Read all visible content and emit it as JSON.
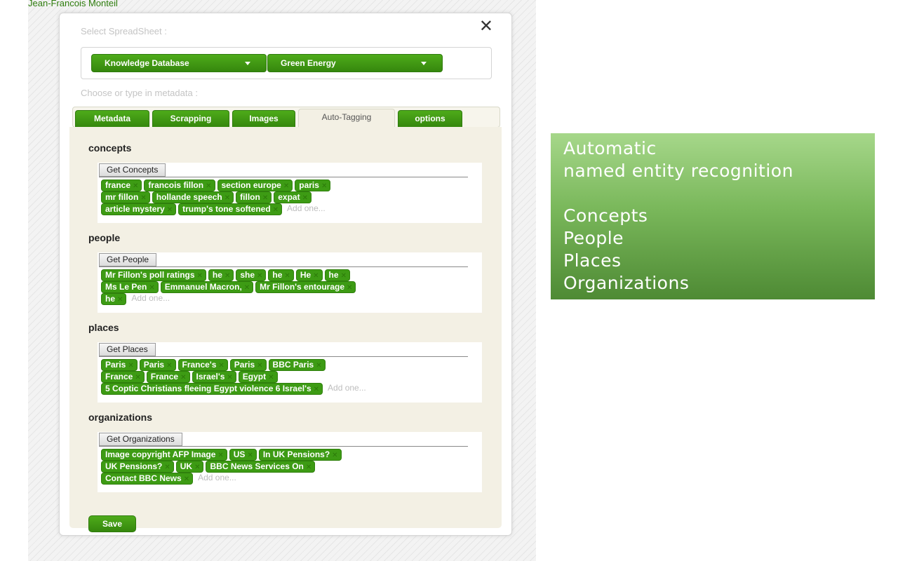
{
  "header": {
    "user_name": "Jean-Francois Monteil"
  },
  "panel": {
    "close_symbol": "✕",
    "select_label": "Select SpreadSheet :",
    "dropdowns": [
      "Knowledge Database",
      "Green Energy"
    ],
    "metadata_label": "Choose or type in metadata :",
    "tabs": [
      {
        "label": "Metadata",
        "active": false
      },
      {
        "label": "Scrapping",
        "active": false
      },
      {
        "label": "Images",
        "active": false
      },
      {
        "label": "Auto-Tagging",
        "active": true
      },
      {
        "label": "options",
        "active": false
      }
    ],
    "add_placeholder": "Add one...",
    "remove_symbol": "✕",
    "sections": {
      "concepts": {
        "title": "concepts",
        "button": "Get Concepts",
        "rows": [
          [
            "france",
            "francois fillon",
            "section europe",
            "paris"
          ],
          [
            "mr fillon",
            "hollande speech",
            "fillon",
            "expat"
          ],
          [
            "article mystery",
            "trump's tone softened"
          ]
        ]
      },
      "people": {
        "title": "people",
        "button": "Get People",
        "rows": [
          [
            "Mr Fillon's poll ratings",
            "he",
            "she",
            "he",
            "He",
            "he"
          ],
          [
            "Ms Le Pen",
            "Emmanuel Macron,",
            "Mr Fillon's entourage"
          ],
          [
            "he"
          ]
        ]
      },
      "places": {
        "title": "places",
        "button": "Get Places",
        "rows": [
          [
            "Paris",
            "Paris",
            "France's",
            "Paris",
            "BBC Paris"
          ],
          [
            "France",
            "France",
            "Israel's",
            "Egypt"
          ],
          [
            "5 Coptic Christians fleeing Egypt violence 6 Israel's"
          ]
        ]
      },
      "organizations": {
        "title": "organizations",
        "button": "Get Organizations",
        "rows": [
          [
            "Image copyright AFP Image",
            "US",
            "In UK Pensions?"
          ],
          [
            "UK Pensions?",
            "UK",
            "BBC News Services On"
          ],
          [
            "Contact BBC News"
          ]
        ]
      }
    },
    "save_label": "Save"
  },
  "info_box": {
    "heading_lines": [
      "Automatic",
      "named entity recognition"
    ],
    "items": [
      "Concepts",
      "People",
      "Places",
      "Organizations"
    ]
  },
  "colors": {
    "accent_green": "#3d9b14",
    "user_name_green": "#2e7d0d",
    "content_bg": "#f3f0e4"
  }
}
